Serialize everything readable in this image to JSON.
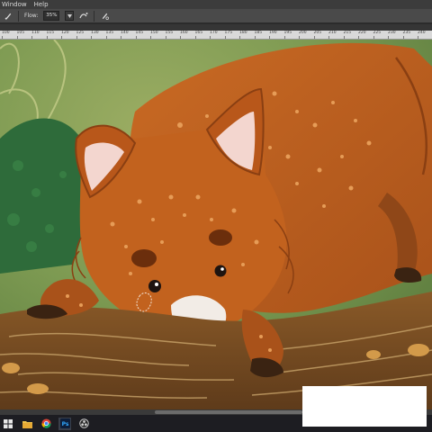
{
  "menubar": {
    "items": [
      "Window",
      "Help"
    ]
  },
  "options": {
    "flow_label": "Flow:",
    "flow_value": "35%"
  },
  "ruler": {
    "labels": [
      "100",
      "105",
      "110",
      "115",
      "120",
      "125",
      "130",
      "135",
      "140",
      "145",
      "150",
      "155",
      "160",
      "165",
      "170",
      "175",
      "180",
      "185",
      "190",
      "195",
      "200",
      "205",
      "210",
      "215",
      "220",
      "225",
      "230",
      "235",
      "240"
    ]
  },
  "colors": {
    "background_green": "#7d9a52",
    "foliage_dark_green": "#2e6b3a",
    "fox_orange": "#c2621e",
    "fox_spots": "#e69c57",
    "ear_inner": "#f3d6cf",
    "log_brown": "#7a4e24",
    "muzzle_white": "#f2ece6"
  },
  "taskbar": {
    "icons": [
      "windows-start-icon",
      "file-explorer-icon",
      "chrome-icon",
      "photoshop-icon",
      "obs-icon"
    ]
  }
}
